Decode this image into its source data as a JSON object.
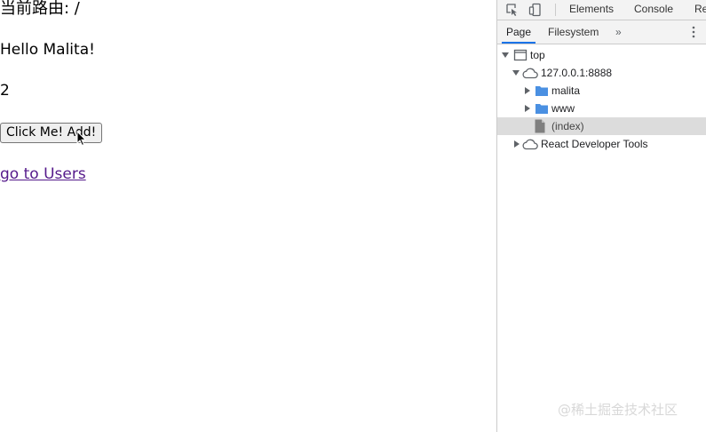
{
  "page": {
    "route_prefix": "当前路由: ",
    "route_value": "/",
    "greeting": "Hello Malita!",
    "count": "2",
    "add_button_label": "Click Me! Add!",
    "users_link_label": "go to Users"
  },
  "devtools": {
    "toolbar_tabs": [
      "Elements",
      "Console",
      "Re"
    ],
    "sub_tabs": [
      "Page",
      "Filesystem"
    ],
    "active_sub_tab": "Page",
    "tree": {
      "top_label": "top",
      "origin_label": "127.0.0.1:8888",
      "folder_1": "malita",
      "folder_2": "www",
      "file_label": "(index)",
      "extension_label": "React Developer Tools"
    },
    "colors": {
      "folder": "#4a90e2",
      "selection": "#dcdcdc",
      "active_tab_underline": "#1a73e8"
    }
  },
  "watermark": "@稀土掘金技术社区",
  "link_color": "#551a8b"
}
